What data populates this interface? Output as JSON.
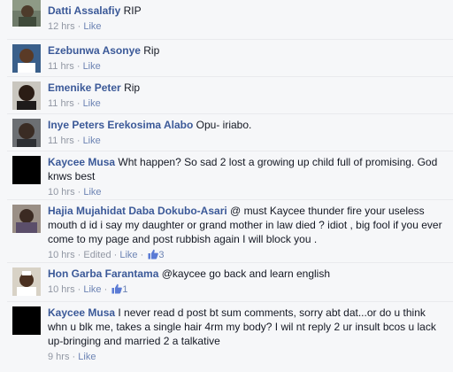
{
  "like_label": "Like",
  "edited_label": "Edited",
  "separator": "·",
  "comments": [
    {
      "author": "Datti Assalafiy",
      "text": "RIP",
      "time": "12 hrs"
    },
    {
      "author": "Ezebunwa Asonye",
      "text": "Rip",
      "time": "11 hrs"
    },
    {
      "author": "Emenike Peter",
      "text": "Rip",
      "time": "11 hrs"
    },
    {
      "author": "Inye Peters Erekosima Alabo",
      "text": "Opu- iriabo.",
      "time": "11 hrs"
    },
    {
      "author": "Kaycee Musa",
      "text": "Wht happen? So sad 2 lost a growing up child full of promising. God knws best",
      "time": "10 hrs"
    },
    {
      "author": "Hajia Mujahidat Daba Dokubo-Asari",
      "text": "@ must Kaycee thunder fire your useless mouth d id i say my daughter or grand mother in law died ? idiot , big fool if you ever come to my page and post rubbish again I will block you .",
      "time": "10 hrs",
      "likes": "3"
    },
    {
      "author": "Hon Garba Farantama",
      "text": "@kaycee go back and learn english",
      "time": "10 hrs",
      "likes": "1"
    },
    {
      "author": "Kaycee Musa",
      "text": "I never read d post bt sum comments, sorry abt dat...or do u think whn u blk me, takes a single hair 4rm my body? I wil nt reply 2 ur insult bcos u lack up-bringing and married 2 a talkative",
      "time": "9 hrs"
    }
  ]
}
